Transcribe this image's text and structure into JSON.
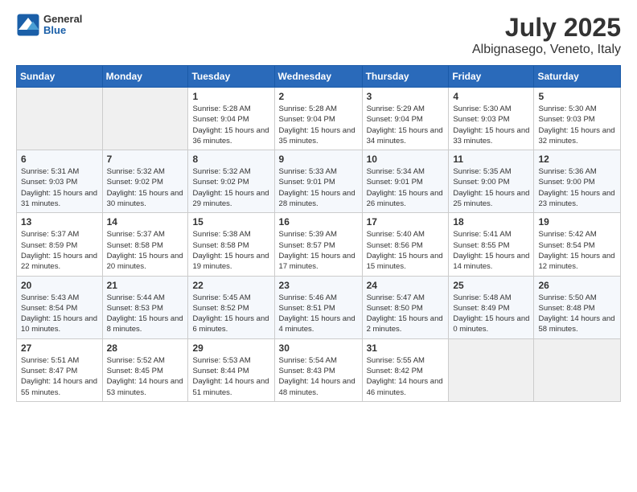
{
  "header": {
    "logo": {
      "general": "General",
      "blue": "Blue"
    },
    "title": "July 2025",
    "location": "Albignasego, Veneto, Italy"
  },
  "weekdays": [
    "Sunday",
    "Monday",
    "Tuesday",
    "Wednesday",
    "Thursday",
    "Friday",
    "Saturday"
  ],
  "weeks": [
    [
      {
        "day": "",
        "info": ""
      },
      {
        "day": "",
        "info": ""
      },
      {
        "day": "1",
        "info": "Sunrise: 5:28 AM\nSunset: 9:04 PM\nDaylight: 15 hours\nand 36 minutes."
      },
      {
        "day": "2",
        "info": "Sunrise: 5:28 AM\nSunset: 9:04 PM\nDaylight: 15 hours\nand 35 minutes."
      },
      {
        "day": "3",
        "info": "Sunrise: 5:29 AM\nSunset: 9:04 PM\nDaylight: 15 hours\nand 34 minutes."
      },
      {
        "day": "4",
        "info": "Sunrise: 5:30 AM\nSunset: 9:03 PM\nDaylight: 15 hours\nand 33 minutes."
      },
      {
        "day": "5",
        "info": "Sunrise: 5:30 AM\nSunset: 9:03 PM\nDaylight: 15 hours\nand 32 minutes."
      }
    ],
    [
      {
        "day": "6",
        "info": "Sunrise: 5:31 AM\nSunset: 9:03 PM\nDaylight: 15 hours\nand 31 minutes."
      },
      {
        "day": "7",
        "info": "Sunrise: 5:32 AM\nSunset: 9:02 PM\nDaylight: 15 hours\nand 30 minutes."
      },
      {
        "day": "8",
        "info": "Sunrise: 5:32 AM\nSunset: 9:02 PM\nDaylight: 15 hours\nand 29 minutes."
      },
      {
        "day": "9",
        "info": "Sunrise: 5:33 AM\nSunset: 9:01 PM\nDaylight: 15 hours\nand 28 minutes."
      },
      {
        "day": "10",
        "info": "Sunrise: 5:34 AM\nSunset: 9:01 PM\nDaylight: 15 hours\nand 26 minutes."
      },
      {
        "day": "11",
        "info": "Sunrise: 5:35 AM\nSunset: 9:00 PM\nDaylight: 15 hours\nand 25 minutes."
      },
      {
        "day": "12",
        "info": "Sunrise: 5:36 AM\nSunset: 9:00 PM\nDaylight: 15 hours\nand 23 minutes."
      }
    ],
    [
      {
        "day": "13",
        "info": "Sunrise: 5:37 AM\nSunset: 8:59 PM\nDaylight: 15 hours\nand 22 minutes."
      },
      {
        "day": "14",
        "info": "Sunrise: 5:37 AM\nSunset: 8:58 PM\nDaylight: 15 hours\nand 20 minutes."
      },
      {
        "day": "15",
        "info": "Sunrise: 5:38 AM\nSunset: 8:58 PM\nDaylight: 15 hours\nand 19 minutes."
      },
      {
        "day": "16",
        "info": "Sunrise: 5:39 AM\nSunset: 8:57 PM\nDaylight: 15 hours\nand 17 minutes."
      },
      {
        "day": "17",
        "info": "Sunrise: 5:40 AM\nSunset: 8:56 PM\nDaylight: 15 hours\nand 15 minutes."
      },
      {
        "day": "18",
        "info": "Sunrise: 5:41 AM\nSunset: 8:55 PM\nDaylight: 15 hours\nand 14 minutes."
      },
      {
        "day": "19",
        "info": "Sunrise: 5:42 AM\nSunset: 8:54 PM\nDaylight: 15 hours\nand 12 minutes."
      }
    ],
    [
      {
        "day": "20",
        "info": "Sunrise: 5:43 AM\nSunset: 8:54 PM\nDaylight: 15 hours\nand 10 minutes."
      },
      {
        "day": "21",
        "info": "Sunrise: 5:44 AM\nSunset: 8:53 PM\nDaylight: 15 hours\nand 8 minutes."
      },
      {
        "day": "22",
        "info": "Sunrise: 5:45 AM\nSunset: 8:52 PM\nDaylight: 15 hours\nand 6 minutes."
      },
      {
        "day": "23",
        "info": "Sunrise: 5:46 AM\nSunset: 8:51 PM\nDaylight: 15 hours\nand 4 minutes."
      },
      {
        "day": "24",
        "info": "Sunrise: 5:47 AM\nSunset: 8:50 PM\nDaylight: 15 hours\nand 2 minutes."
      },
      {
        "day": "25",
        "info": "Sunrise: 5:48 AM\nSunset: 8:49 PM\nDaylight: 15 hours\nand 0 minutes."
      },
      {
        "day": "26",
        "info": "Sunrise: 5:50 AM\nSunset: 8:48 PM\nDaylight: 14 hours\nand 58 minutes."
      }
    ],
    [
      {
        "day": "27",
        "info": "Sunrise: 5:51 AM\nSunset: 8:47 PM\nDaylight: 14 hours\nand 55 minutes."
      },
      {
        "day": "28",
        "info": "Sunrise: 5:52 AM\nSunset: 8:45 PM\nDaylight: 14 hours\nand 53 minutes."
      },
      {
        "day": "29",
        "info": "Sunrise: 5:53 AM\nSunset: 8:44 PM\nDaylight: 14 hours\nand 51 minutes."
      },
      {
        "day": "30",
        "info": "Sunrise: 5:54 AM\nSunset: 8:43 PM\nDaylight: 14 hours\nand 48 minutes."
      },
      {
        "day": "31",
        "info": "Sunrise: 5:55 AM\nSunset: 8:42 PM\nDaylight: 14 hours\nand 46 minutes."
      },
      {
        "day": "",
        "info": ""
      },
      {
        "day": "",
        "info": ""
      }
    ]
  ]
}
